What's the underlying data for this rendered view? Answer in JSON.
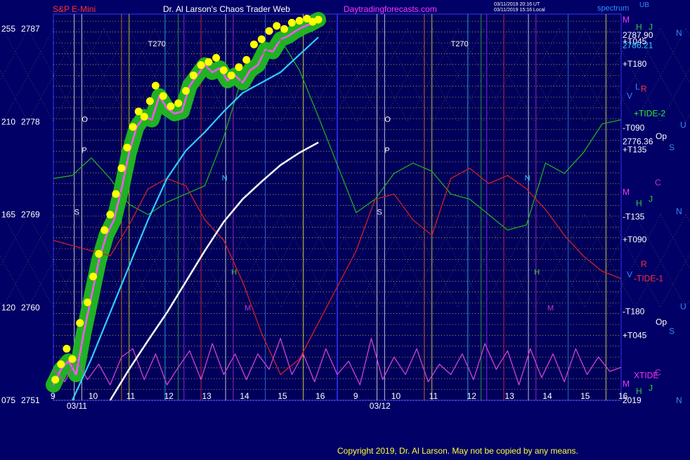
{
  "header": {
    "instrument": "S&P E-Mini",
    "title": "Dr. Al Larson's Chaos Trader Web",
    "website": "Daytradingforecasts.com",
    "stamp_line1": "03/11/2019 20:16 UT",
    "stamp_line2": "03/11/2019 15:16 Local",
    "brand": "spectrum",
    "brand_corner": "UB"
  },
  "footer": {
    "copyright": "Copyright 2019, Dr. Al Larson. May not be copied by any means."
  },
  "colors": {
    "background": "#000066",
    "plot_bg": "#00005a",
    "price": "#ff55ff",
    "band": "#22bb22",
    "dots": "#ffff00",
    "avg_line": "#33ccff",
    "forecast": "#ffffff",
    "tide2": "#22aa22",
    "tide1": "#cc2222",
    "xtide": "#cc44cc",
    "grid": "#ffff66"
  },
  "chart_data": {
    "type": "line",
    "title": "S&P E-Mini",
    "x_axis": {
      "type": "time",
      "day_labels": [
        "03/11",
        "03/12"
      ],
      "hour_labels_day1": [
        "9",
        "10",
        "11",
        "12",
        "13",
        "14",
        "15",
        "16"
      ],
      "hour_labels_day2": [
        "9",
        "10",
        "11",
        "12",
        "13",
        "14",
        "15",
        "16"
      ],
      "sessions": 2,
      "hours_per_session": 8
    },
    "y_axis": {
      "range": [
        2751,
        2787.9
      ],
      "price_ticks": [
        "2787",
        "2778",
        "2769",
        "2760",
        "2751"
      ],
      "degree_ticks": [
        "255",
        "210",
        "165",
        "120",
        "075"
      ],
      "tick_values": [
        2787,
        2778,
        2769,
        2760,
        2751
      ]
    },
    "right_labels": [
      {
        "text": "M",
        "value": 2787.9,
        "color": "#ff33ff"
      },
      {
        "text": "H",
        "value": 2787.2,
        "color": "#33cc33"
      },
      {
        "text": "J",
        "value": 2787.2,
        "color": "#33cc33"
      },
      {
        "text": "2787.90",
        "value": 2786.4,
        "color": "#ffffff"
      },
      {
        "text": "N",
        "value": 2786.6,
        "color": "#3388ff"
      },
      {
        "text": "+T045",
        "value": 2785.8,
        "color": "#ffffff"
      },
      {
        "text": "2786.21",
        "value": 2785.4,
        "color": "#33ccff"
      },
      {
        "text": "+T180",
        "value": 2783.6,
        "color": "#ffffff"
      },
      {
        "text": "L",
        "value": 2781.4,
        "color": "#3388ff"
      },
      {
        "text": "R",
        "value": 2781.2,
        "color": "#ff3333"
      },
      {
        "text": "V",
        "value": 2780.5,
        "color": "#3388ff"
      },
      {
        "text": "+TIDE-2",
        "value": 2778.8,
        "color": "#33ee33"
      },
      {
        "text": "U",
        "value": 2777.7,
        "color": "#3388ff"
      },
      {
        "text": "-T090",
        "value": 2777.4,
        "color": "#ffffff"
      },
      {
        "text": "Op",
        "value": 2776.6,
        "color": "#ffffff"
      },
      {
        "text": "2776.36",
        "value": 2776.1,
        "color": "#ffffff"
      },
      {
        "text": "S",
        "value": 2775.5,
        "color": "#3388ff"
      },
      {
        "text": "+T135",
        "value": 2775.3,
        "color": "#ffffff"
      },
      {
        "text": "C",
        "value": 2772.1,
        "color": "#cc33cc"
      },
      {
        "text": "M",
        "value": 2771.2,
        "color": "#ff33ff"
      },
      {
        "text": "J",
        "value": 2770.5,
        "color": "#33cc33"
      },
      {
        "text": "H",
        "value": 2770.1,
        "color": "#33cc33"
      },
      {
        "text": "N",
        "value": 2769.3,
        "color": "#3388ff"
      },
      {
        "text": "-T135",
        "value": 2768.8,
        "color": "#ffffff"
      },
      {
        "text": "+T090",
        "value": 2766.6,
        "color": "#ffffff"
      },
      {
        "text": "R",
        "value": 2764.2,
        "color": "#ff3333"
      },
      {
        "text": "V",
        "value": 2763.2,
        "color": "#3388ff"
      },
      {
        "text": "-TIDE-1",
        "value": 2762.8,
        "color": "#ff3333"
      },
      {
        "text": "U",
        "value": 2760.1,
        "color": "#3388ff"
      },
      {
        "text": "-T180",
        "value": 2759.6,
        "color": "#ffffff"
      },
      {
        "text": "Op",
        "value": 2758.6,
        "color": "#ffffff"
      },
      {
        "text": "S",
        "value": 2757.7,
        "color": "#3388ff"
      },
      {
        "text": "+T045",
        "value": 2757.3,
        "color": "#ffffff"
      },
      {
        "text": "C",
        "value": 2753.7,
        "color": "#cc33cc"
      },
      {
        "text": "XTIDE",
        "value": 2753.4,
        "color": "#ff33ff"
      },
      {
        "text": "M",
        "value": 2752.6,
        "color": "#ff33ff"
      },
      {
        "text": "J",
        "value": 2752.2,
        "color": "#33cc33"
      },
      {
        "text": "H",
        "value": 2751.9,
        "color": "#33cc33"
      },
      {
        "text": "2019",
        "value": 2751.0,
        "color": "#ffffff"
      },
      {
        "text": "N",
        "value": 2751.0,
        "color": "#3388ff"
      }
    ],
    "chart_markers": [
      {
        "text": "T270",
        "value": 2785.3,
        "session": 1
      },
      {
        "text": "T270",
        "value": 2785.3,
        "session": 2
      },
      {
        "text": "O",
        "value": 2778.0,
        "session": 1
      },
      {
        "text": "P",
        "value": 2775.0,
        "session": 1
      },
      {
        "text": "S",
        "value": 2769.0,
        "session": 1
      },
      {
        "text": "O",
        "value": 2778.0,
        "session": 2
      },
      {
        "text": "P",
        "value": 2775.0,
        "session": 2
      },
      {
        "text": "S",
        "value": 2769.0,
        "session": 2
      },
      {
        "text": "N",
        "value": 2772.3,
        "session": 1
      },
      {
        "text": "N",
        "value": 2772.3,
        "session": 2
      },
      {
        "text": "H",
        "value": 2763.2,
        "session": 1
      },
      {
        "text": "H",
        "value": 2763.2,
        "session": 2
      },
      {
        "text": "M",
        "value": 2759.7,
        "session": 1
      },
      {
        "text": "M",
        "value": 2759.7,
        "session": 2
      }
    ],
    "series": [
      {
        "name": "S&P E-Mini",
        "color": "#ff55ff",
        "x": [
          9.0,
          9.2,
          9.4,
          9.6,
          9.8,
          10.0,
          10.2,
          10.4,
          10.6,
          10.8,
          11.0,
          11.2,
          11.4,
          11.6,
          11.8,
          12.0,
          12.2,
          12.4,
          12.6,
          12.8,
          13.0,
          13.2,
          13.4,
          13.6,
          13.8,
          14.0,
          14.2,
          14.4,
          14.6,
          14.8,
          15.0,
          15.2,
          15.4,
          15.6,
          15.8,
          16.0
        ],
        "values": [
          2752.5,
          2754.0,
          2754.8,
          2753.5,
          2757.5,
          2761.0,
          2764.5,
          2767.0,
          2768.5,
          2771.5,
          2775.0,
          2777.5,
          2778.5,
          2778.2,
          2780.5,
          2779.3,
          2778.8,
          2779.0,
          2781.5,
          2782.5,
          2783.5,
          2782.8,
          2783.2,
          2782.0,
          2782.5,
          2781.8,
          2783.0,
          2783.5,
          2785.0,
          2784.8,
          2786.0,
          2786.3,
          2786.8,
          2787.2,
          2787.5,
          2787.9
        ]
      },
      {
        "name": "+TIDE-2",
        "color": "#22aa22",
        "x": [
          9.0,
          9.5,
          10.0,
          10.5,
          11.0,
          11.5,
          12.0,
          12.5,
          13.0,
          13.5,
          14.0,
          14.5,
          15.0,
          15.5,
          16.0,
          17.0,
          17.5,
          18.0,
          18.5,
          19.0,
          19.5,
          20.0,
          20.5,
          21.0,
          21.5,
          22.0,
          22.5,
          23.0,
          23.5,
          24.0
        ],
        "values": [
          2772.5,
          2772.8,
          2774.5,
          2772.5,
          2770.0,
          2769.0,
          2770.2,
          2771.0,
          2771.8,
          2776.5,
          2782.5,
          2784.5,
          2786.0,
          2783.0,
          2778.5,
          2769.2,
          2770.5,
          2773.0,
          2774.0,
          2773.2,
          2771.0,
          2770.5,
          2769.0,
          2767.5,
          2768.0,
          2774.0,
          2773.0,
          2775.0,
          2777.8,
          2778.2
        ]
      },
      {
        "name": "-TIDE-1",
        "color": "#cc2222",
        "x": [
          9.0,
          9.5,
          10.0,
          10.5,
          11.0,
          11.5,
          12.0,
          12.5,
          13.0,
          13.5,
          14.0,
          14.5,
          15.0,
          15.5,
          16.0,
          17.0,
          17.5,
          18.0,
          18.5,
          19.0,
          19.5,
          20.0,
          20.5,
          21.0,
          21.5,
          22.0,
          22.5,
          23.0,
          23.5,
          24.0
        ],
        "values": [
          2766.5,
          2766.0,
          2765.5,
          2765.0,
          2768.0,
          2771.5,
          2772.5,
          2771.8,
          2768.5,
          2766.5,
          2762.5,
          2757.5,
          2753.5,
          2755.0,
          2758.5,
          2765.5,
          2770.5,
          2771.0,
          2768.5,
          2767.0,
          2772.5,
          2773.5,
          2772.0,
          2772.8,
          2771.5,
          2769.5,
          2767.0,
          2765.0,
          2763.5,
          2762.8
        ]
      },
      {
        "name": "XTIDE",
        "color": "#cc44cc",
        "x": [
          9.0,
          9.3,
          9.6,
          9.9,
          10.2,
          10.5,
          10.8,
          11.1,
          11.4,
          11.7,
          12.0,
          12.3,
          12.6,
          12.9,
          13.2,
          13.5,
          13.8,
          14.1,
          14.4,
          14.7,
          15.0,
          15.3,
          15.6,
          15.9,
          16.2,
          16.5,
          16.8,
          17.1,
          17.4,
          17.7,
          18.0,
          18.3,
          18.6,
          18.9,
          19.2,
          19.5,
          19.8,
          20.1,
          20.4,
          20.7,
          21.0,
          21.3,
          21.6,
          21.9,
          22.2,
          22.5,
          22.8,
          23.1,
          23.4,
          23.7,
          24.0
        ],
        "values": [
          2754.0,
          2752.8,
          2755.0,
          2753.0,
          2754.5,
          2752.5,
          2755.2,
          2756.0,
          2753.0,
          2755.5,
          2752.5,
          2754.2,
          2755.8,
          2753.0,
          2756.5,
          2753.5,
          2755.5,
          2753.0,
          2755.5,
          2754.0,
          2757.0,
          2753.5,
          2755.5,
          2752.8,
          2756.0,
          2753.5,
          2754.8,
          2752.5,
          2757.0,
          2753.0,
          2755.2,
          2753.5,
          2756.0,
          2752.8,
          2754.5,
          2753.5,
          2755.5,
          2753.0,
          2756.5,
          2754.0,
          2755.8,
          2752.5,
          2756.0,
          2753.2,
          2755.5,
          2752.8,
          2756.0,
          2753.5,
          2755.2,
          2753.8,
          2754.2
        ]
      },
      {
        "name": "Average",
        "color": "#33ccff",
        "x": [
          9.5,
          10.0,
          10.5,
          11.0,
          11.5,
          12.0,
          12.5,
          13.0,
          13.5,
          14.0,
          14.5,
          15.0,
          15.5,
          16.0
        ],
        "values": [
          2751.0,
          2755.0,
          2759.5,
          2764.0,
          2768.5,
          2772.5,
          2775.2,
          2777.0,
          2779.0,
          2780.8,
          2781.8,
          2782.8,
          2784.5,
          2786.2
        ]
      },
      {
        "name": "Forecast",
        "color": "#ffffff",
        "x": [
          10.5,
          11.0,
          11.5,
          12.0,
          12.5,
          13.0,
          13.5,
          14.0,
          14.5,
          15.0,
          15.5,
          16.0
        ],
        "values": [
          2751.0,
          2754.0,
          2756.8,
          2759.5,
          2762.5,
          2765.5,
          2768.3,
          2770.5,
          2772.2,
          2773.8,
          2775.0,
          2776.0
        ]
      }
    ],
    "dots_x": [
      9.05,
      9.2,
      9.35,
      9.5,
      9.7,
      9.9,
      10.05,
      10.2,
      10.35,
      10.5,
      10.65,
      10.8,
      10.95,
      11.1,
      11.25,
      11.4,
      11.55,
      11.7,
      11.9,
      12.1,
      12.3,
      12.5,
      12.7,
      12.9,
      13.1,
      13.3,
      13.5,
      13.7,
      13.9,
      14.1,
      14.3,
      14.5,
      14.7,
      14.9,
      15.1,
      15.3,
      15.5,
      15.7,
      15.85,
      16.0
    ],
    "dots_y": [
      2753.0,
      2754.5,
      2756.0,
      2755.0,
      2758.5,
      2760.5,
      2763.0,
      2765.2,
      2767.5,
      2769.0,
      2771.0,
      2773.5,
      2775.5,
      2777.5,
      2779.0,
      2778.5,
      2780.0,
      2781.5,
      2780.5,
      2779.5,
      2779.8,
      2781.0,
      2782.5,
      2783.5,
      2783.8,
      2784.2,
      2783.0,
      2782.5,
      2783.3,
      2784.0,
      2785.5,
      2786.0,
      2786.8,
      2787.3,
      2787.0,
      2787.6,
      2787.8,
      2788.0,
      2787.7,
      2787.9
    ],
    "band_start": 9.0,
    "band_end": 16.0
  }
}
